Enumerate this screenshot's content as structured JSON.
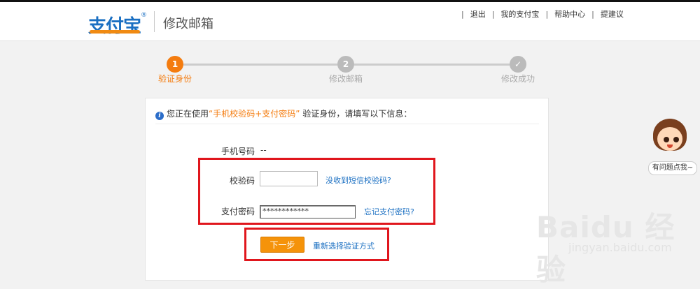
{
  "header": {
    "logo_text": "支付宝",
    "page_title": "修改邮箱",
    "nav": [
      "退出",
      "我的支付宝",
      "帮助中心",
      "提建议"
    ],
    "separator": "|"
  },
  "steps": [
    {
      "number": "1",
      "label": "验证身份",
      "state": "active"
    },
    {
      "number": "2",
      "label": "修改邮箱",
      "state": "pending"
    },
    {
      "number": "✓",
      "label": "修改成功",
      "state": "pending"
    }
  ],
  "notice": {
    "prefix": "您正在使用",
    "highlight": "“手机校验码+支付密码”",
    "suffix": "验证身份，请填写以下信息："
  },
  "form": {
    "phone_label": "手机号码",
    "phone_value": "--",
    "code_label": "校验码",
    "code_value": "",
    "no_sms_link": "没收到短信校验码?",
    "password_label": "支付密码",
    "password_value": "************",
    "forgot_link": "忘记支付密码?",
    "next_button": "下一步",
    "reselect_link": "重新选择验证方式"
  },
  "helper": {
    "bubble_text": "有问题点我~"
  },
  "watermark": {
    "brand": "Baidu 经验",
    "url": "jingyan.baidu.com"
  },
  "colors": {
    "accent": "#f47c0f",
    "link": "#1a6fc2",
    "highlight_box": "#e0161d"
  }
}
